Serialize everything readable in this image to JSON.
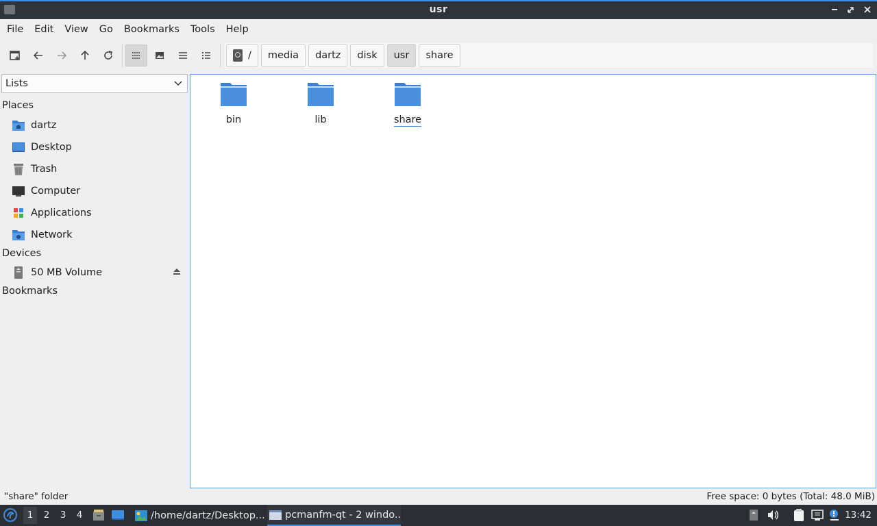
{
  "window": {
    "title": "usr"
  },
  "menu": [
    "File",
    "Edit",
    "View",
    "Go",
    "Bookmarks",
    "Tools",
    "Help"
  ],
  "breadcrumbs": [
    "/",
    "media",
    "dartz",
    "disk",
    "usr",
    "share"
  ],
  "sidebar": {
    "combo_value": "Lists",
    "places_header": "Places",
    "places": [
      "dartz",
      "Desktop",
      "Trash",
      "Computer",
      "Applications",
      "Network"
    ],
    "devices_header": "Devices",
    "devices": [
      "50 MB Volume"
    ],
    "bookmarks_header": "Bookmarks"
  },
  "files": [
    {
      "name": "bin",
      "selected": false
    },
    {
      "name": "lib",
      "selected": false
    },
    {
      "name": "share",
      "selected": true
    }
  ],
  "status": {
    "left": "\"share\" folder",
    "right": "Free space: 0 bytes (Total: 48.0 MiB)"
  },
  "taskbar": {
    "workspaces": [
      "1",
      "2",
      "3",
      "4"
    ],
    "active_workspace": "1",
    "tasks": [
      "/home/dartz/Desktop...",
      "pcmanfm-qt - 2 windo..."
    ],
    "clock": "13:42"
  },
  "colors": {
    "accent": "#3d8ee0",
    "folder": "#4a8fdb",
    "titlebar": "#2f343b",
    "taskbar": "#2b2e33"
  }
}
